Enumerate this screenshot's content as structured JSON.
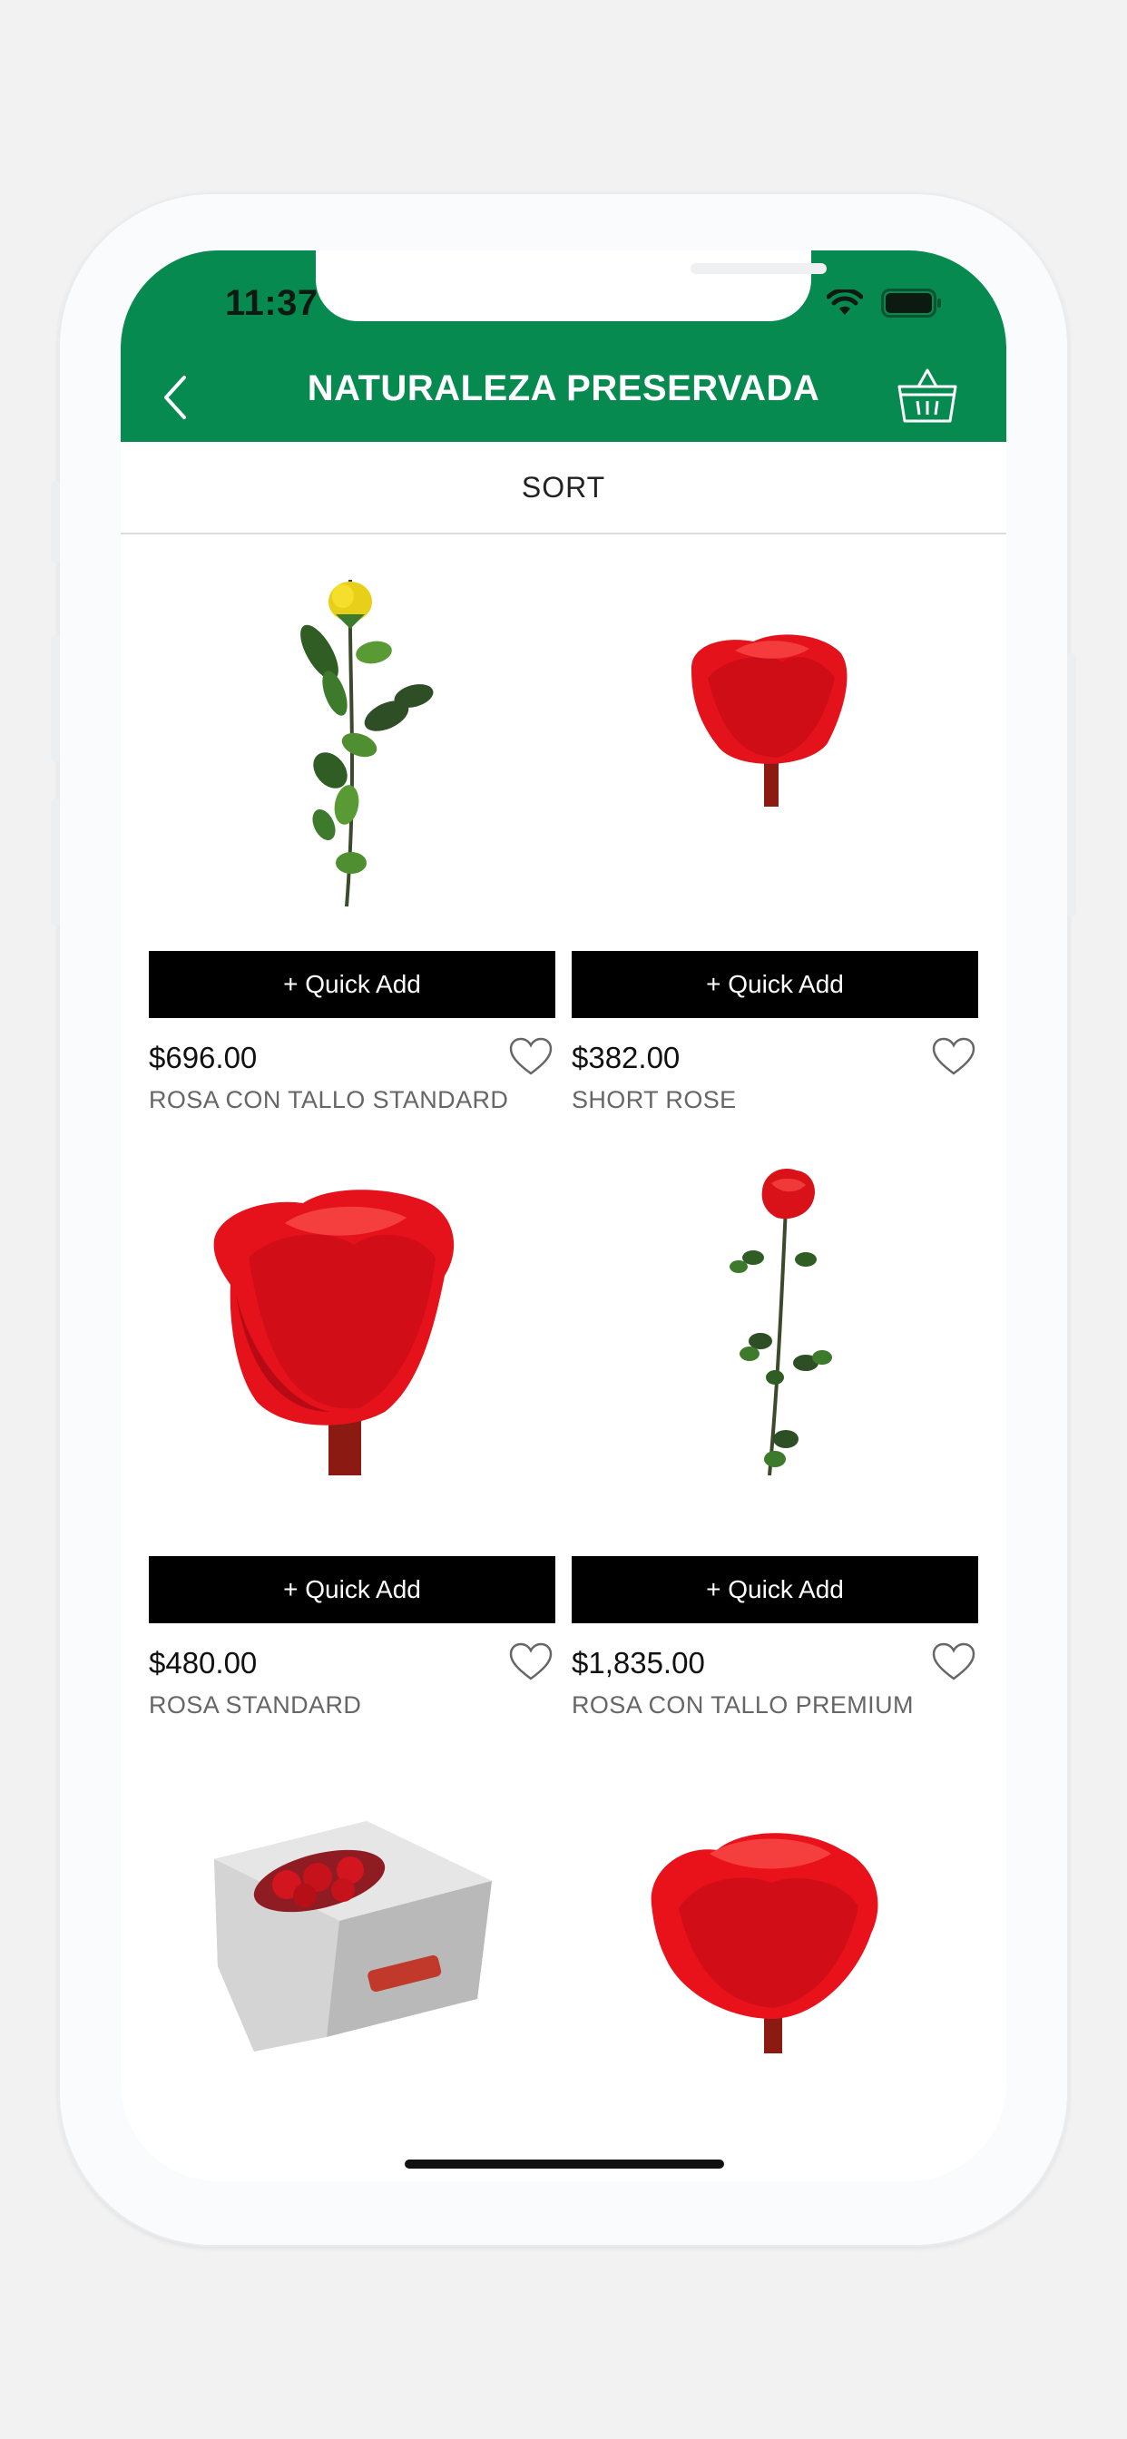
{
  "status_bar": {
    "time": "11:37"
  },
  "header": {
    "title": "NATURALEZA PRESERVADA",
    "back_icon": "chevron-left-icon",
    "cart_icon": "basket-icon"
  },
  "sort": {
    "label": "SORT"
  },
  "colors": {
    "brand_green": "#068a4f",
    "button_black": "#000000"
  },
  "products": [
    {
      "price": "$696.00",
      "name": "ROSA CON TALLO STANDARD",
      "quick_add": "+ Quick Add",
      "image": "yellow-long-stem-rose"
    },
    {
      "price": "$382.00",
      "name": "SHORT ROSE",
      "quick_add": "+ Quick Add",
      "image": "red-rose-head"
    },
    {
      "price": "$480.00",
      "name": "ROSA STANDARD",
      "quick_add": "+ Quick Add",
      "image": "large-red-rose-head"
    },
    {
      "price": "$1,835.00",
      "name": "ROSA CON TALLO PREMIUM",
      "quick_add": "+ Quick Add",
      "image": "red-long-stem-rose"
    },
    {
      "image": "boxed-preserved-roses"
    },
    {
      "image": "red-rose-bloom"
    }
  ]
}
